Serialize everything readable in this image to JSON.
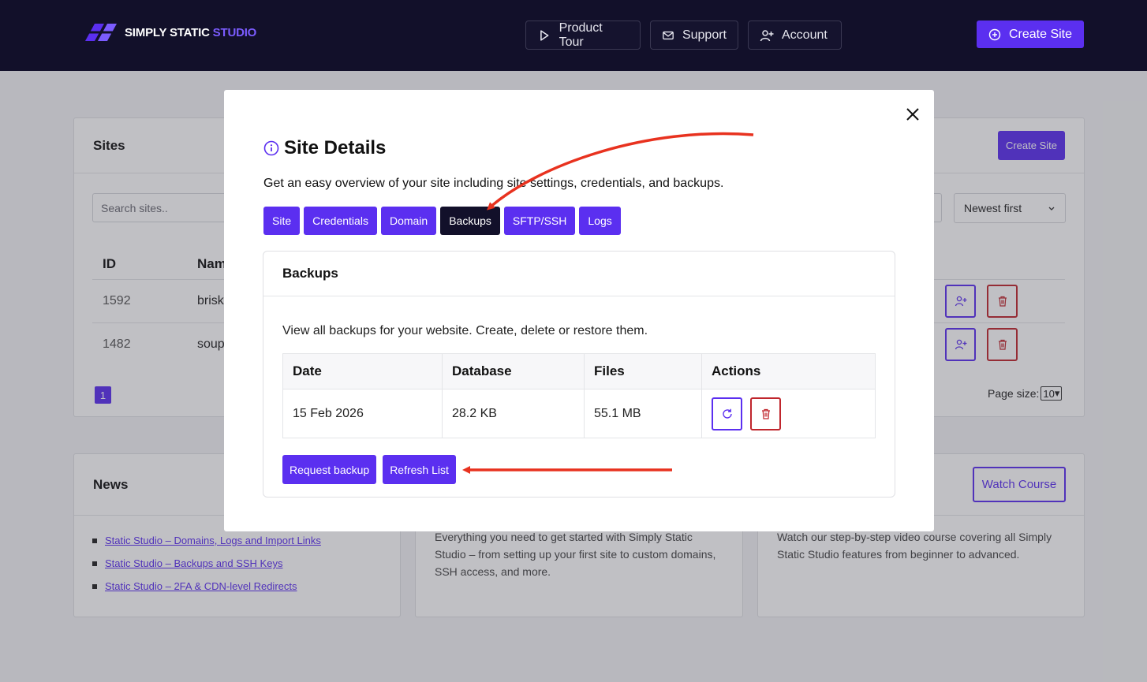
{
  "brand": {
    "name_main": "SIMPLY STATIC",
    "name_accent": "STUDIO"
  },
  "nav": {
    "product_tour": "Product Tour",
    "support": "Support",
    "account": "Account",
    "create_site": "Create Site"
  },
  "sites_card": {
    "title": "Sites",
    "create_label": "Create Site",
    "search_placeholder": "Search sites..",
    "sort_value": "Newest first",
    "headers": {
      "id": "ID",
      "name": "Nam"
    },
    "rows": [
      {
        "id": "1592",
        "name": "brisk"
      },
      {
        "id": "1482",
        "name": "soup"
      }
    ],
    "page": "1",
    "page_size_label": "Page size:",
    "page_size_value": "10"
  },
  "news_card": {
    "title": "News",
    "items": [
      "Static Studio – Domains, Logs and Import Links",
      "Static Studio – Backups and SSH Keys",
      "Static Studio – 2FA & CDN-level Redirects"
    ]
  },
  "guide_card": {
    "text": "Everything you need to get started with Simply Static Studio – from setting up your first site to custom domains, SSH access, and more."
  },
  "course_card": {
    "button": "Watch Course",
    "text": "Watch our step-by-step video course covering all Simply Static Studio features from beginner to advanced."
  },
  "modal": {
    "title": "Site Details",
    "description": "Get an easy overview of your site including site settings, credentials, and backups.",
    "tabs": [
      "Site",
      "Credentials",
      "Domain",
      "Backups",
      "SFTP/SSH",
      "Logs"
    ],
    "active_tab": "Backups",
    "panel": {
      "title": "Backups",
      "description": "View all backups for your website. Create, delete or restore them.",
      "columns": [
        "Date",
        "Database",
        "Files",
        "Actions"
      ],
      "rows": [
        {
          "date": "15 Feb 2026",
          "database": "28.2 KB",
          "files": "55.1 MB"
        }
      ],
      "request_backup": "Request backup",
      "refresh_list": "Refresh List"
    }
  },
  "colors": {
    "accent": "#5b2ff0",
    "nav_bg": "#12102a",
    "danger": "#c0262d",
    "annotation": "#e8321f"
  }
}
